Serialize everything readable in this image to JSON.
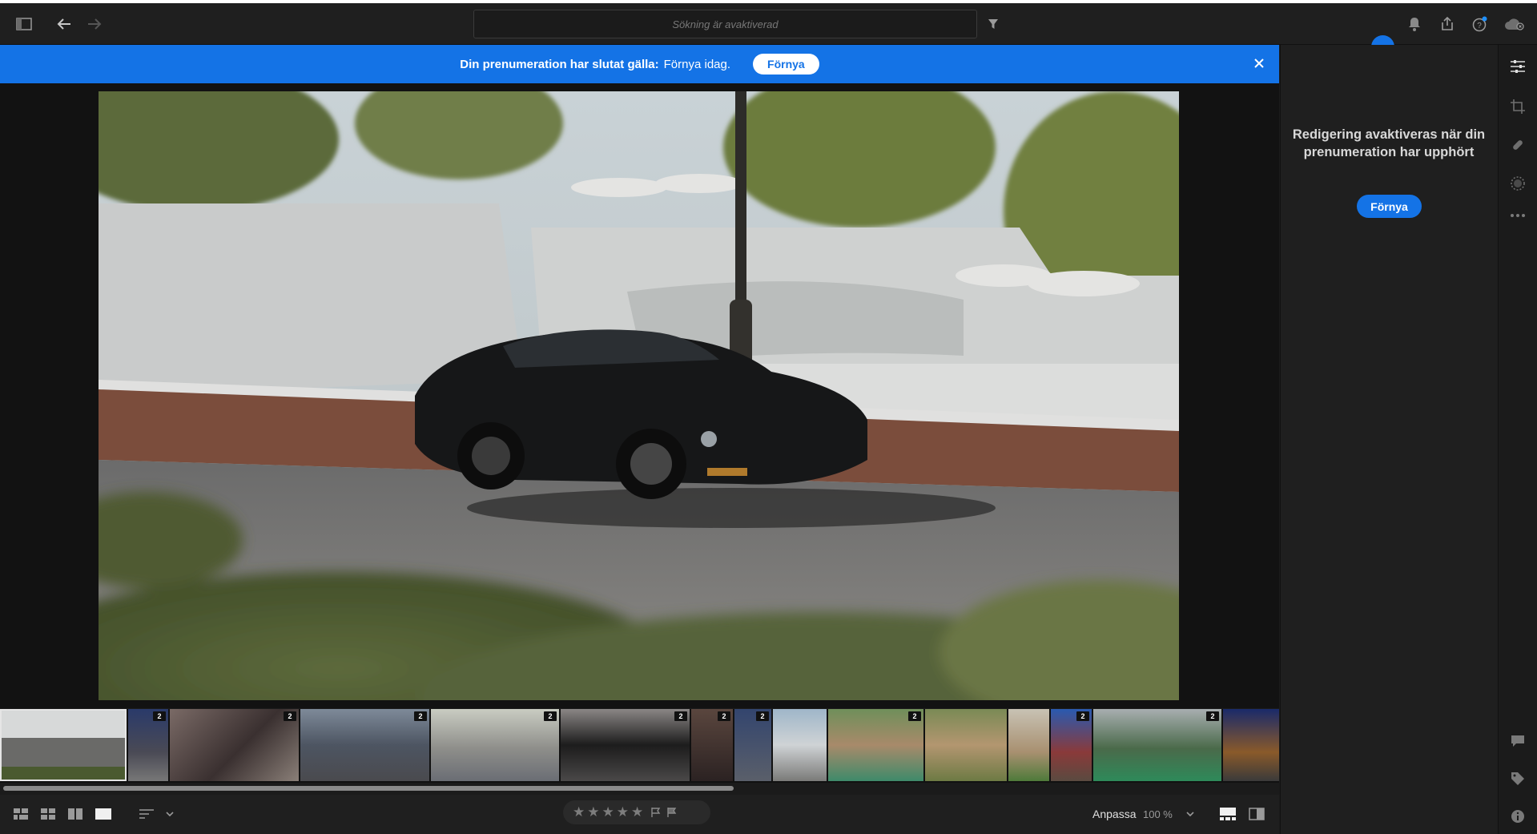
{
  "toolbar": {
    "search_placeholder": "Sökning är avaktiverad",
    "icons": [
      "sidebar-toggle-icon",
      "back-arrow-icon",
      "forward-arrow-icon",
      "filter-icon",
      "bell-icon",
      "share-icon",
      "help-icon",
      "cloud-status-icon"
    ]
  },
  "banner": {
    "message_bold": "Din prenumeration har slutat gälla:",
    "message_renew": "Förnya idag.",
    "button_label": "Förnya",
    "close_icon": "close-icon",
    "color": "#1473e6"
  },
  "main": {
    "photo_description_icon": "car-photo"
  },
  "filmstrip": {
    "thumbnails": [
      {
        "badge": ""
      },
      {
        "badge": "2"
      },
      {
        "badge": "2"
      },
      {
        "badge": "2"
      },
      {
        "badge": "2"
      },
      {
        "badge": "2"
      },
      {
        "badge": "2"
      },
      {
        "badge": "2"
      },
      {
        "badge": ""
      },
      {
        "badge": "2"
      },
      {
        "badge": ""
      },
      {
        "badge": ""
      },
      {
        "badge": "2"
      },
      {
        "badge": "2"
      },
      {
        "badge": ""
      }
    ]
  },
  "bottombar": {
    "rating_stars": "★★★★★",
    "fit_label": "Anpassa",
    "zoom_label": "100 %"
  },
  "right_panel": {
    "message": "Redigering avaktiveras när din prenumeration har upphört",
    "button_label": "Förnya"
  },
  "colors": {
    "accent": "#1473e6",
    "background": "#1b1b1b"
  }
}
